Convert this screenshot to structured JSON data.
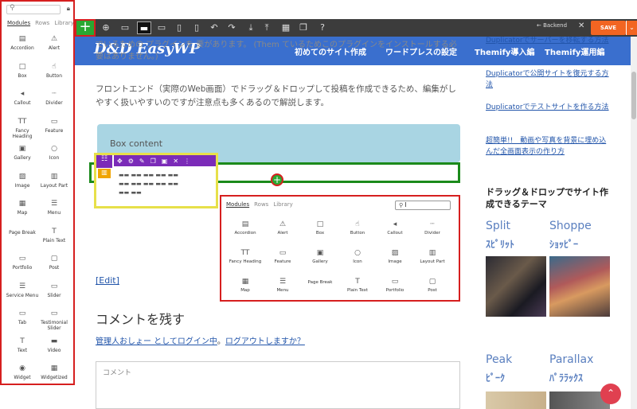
{
  "side_panel": {
    "tabs": [
      "Modules",
      "Rows",
      "Library"
    ],
    "modules": [
      {
        "label": "Accordion",
        "icon": "accordion-icon",
        "glyph": "▤"
      },
      {
        "label": "Alert",
        "icon": "alert-icon",
        "glyph": "⚠"
      },
      {
        "label": "Box",
        "icon": "box-icon",
        "glyph": "□"
      },
      {
        "label": "Button",
        "icon": "button-icon",
        "glyph": "☝"
      },
      {
        "label": "Callout",
        "icon": "callout-icon",
        "glyph": "◂"
      },
      {
        "label": "Divider",
        "icon": "divider-icon",
        "glyph": "┈"
      },
      {
        "label": "Fancy Heading",
        "icon": "fancy-heading-icon",
        "glyph": "TT"
      },
      {
        "label": "Feature",
        "icon": "feature-icon",
        "glyph": "▭"
      },
      {
        "label": "Gallery",
        "icon": "gallery-icon",
        "glyph": "▣"
      },
      {
        "label": "Icon",
        "icon": "icon-icon",
        "glyph": "○"
      },
      {
        "label": "Image",
        "icon": "image-icon",
        "glyph": "▨"
      },
      {
        "label": "Layout Part",
        "icon": "layout-part-icon",
        "glyph": "▥"
      },
      {
        "label": "Map",
        "icon": "map-icon",
        "glyph": "▦"
      },
      {
        "label": "Menu",
        "icon": "menu-icon",
        "glyph": "☰"
      },
      {
        "label": "Page Break",
        "icon": "page-break-icon",
        "glyph": ""
      },
      {
        "label": "Plain Text",
        "icon": "plain-text-icon",
        "glyph": "T"
      },
      {
        "label": "Portfolio",
        "icon": "portfolio-icon",
        "glyph": "▭"
      },
      {
        "label": "Post",
        "icon": "post-icon",
        "glyph": "▢"
      },
      {
        "label": "Service Menu",
        "icon": "service-menu-icon",
        "glyph": "☰"
      },
      {
        "label": "Slider",
        "icon": "slider-icon",
        "glyph": "▭"
      },
      {
        "label": "Tab",
        "icon": "tab-icon",
        "glyph": "▭"
      },
      {
        "label": "Testimonial Slider",
        "icon": "testimonial-slider-icon",
        "glyph": "▭"
      },
      {
        "label": "Text",
        "icon": "text-icon",
        "glyph": "T"
      },
      {
        "label": "Video",
        "icon": "video-icon",
        "glyph": "▬"
      },
      {
        "label": "Widget",
        "icon": "widget-icon",
        "glyph": "◉"
      },
      {
        "label": "Widgetized",
        "icon": "widgetized-icon",
        "glyph": "▦"
      }
    ]
  },
  "toolbar": {
    "add_label": "+",
    "backend_label": "← Backend",
    "close_label": "✕",
    "save_label": "SAVE",
    "save_arrow": "⌄"
  },
  "header": {
    "logo": "D&D EasyWP",
    "nav": [
      "初めてのサイト作成",
      "ワードプレスの設定",
      "Themify導入編",
      "Themify運用編"
    ],
    "behind_text": "Themifyのデータ すべてのThemifyのテーマやプラグインを使用する場合は、どのThemify Builder でいるための プラグインを 要があります。 (Them ているためこのプラグインをインストールする必要はありません。)"
  },
  "content": {
    "intro": "フロントエンド（実際のWeb画面）でドラッグ＆ドロップして投稿を作成できるため、編集がしやすく扱いやすいのですが注意点も多くあるので解説します。",
    "box_content": "Box content",
    "row_grid": [
      "▬▬ ▬▬ ▬▬ ▬▬ ▬▬",
      "▬▬ ▬▬ ▬▬ ▬▬ ▬▬",
      "▬▬ ▬▬"
    ],
    "edit_link": "[Edit]",
    "comment_title": "コメントを残す",
    "logged_prefix": "管理人おしょー としてログイン中",
    "logged_sep": "。",
    "logout_link": "ログアウトしますか？",
    "comment_placeholder": "コメント"
  },
  "popup": {
    "tabs": [
      "Modules",
      "Rows",
      "Library"
    ],
    "search_value": "I",
    "modules": [
      {
        "label": "Accordion",
        "glyph": "▤"
      },
      {
        "label": "Alert",
        "glyph": "⚠"
      },
      {
        "label": "Box",
        "glyph": "□"
      },
      {
        "label": "Button",
        "glyph": "☝"
      },
      {
        "label": "Callout",
        "glyph": "◂"
      },
      {
        "label": "Divider",
        "glyph": "┈"
      },
      {
        "label": "Fancy Heading",
        "glyph": "TT"
      },
      {
        "label": "Feature",
        "glyph": "▭"
      },
      {
        "label": "Gallery",
        "glyph": "▣"
      },
      {
        "label": "Icon",
        "glyph": "○"
      },
      {
        "label": "Image",
        "glyph": "▨"
      },
      {
        "label": "Layout Part",
        "glyph": "▥"
      },
      {
        "label": "Map",
        "glyph": "▦"
      },
      {
        "label": "Menu",
        "glyph": "☰"
      },
      {
        "label": "Page Break",
        "glyph": ""
      },
      {
        "label": "Plain Text",
        "glyph": "T"
      },
      {
        "label": "Portfolio",
        "glyph": "▭"
      },
      {
        "label": "Post",
        "glyph": "▢"
      }
    ]
  },
  "sidebar": {
    "links": [
      "Duplicatorでサーバーを移転する方法",
      "Duplicatorで公開サイトを復元する方法",
      "Duplicatorでテストサイトを作る方法",
      "超簡単!!　動画や写真を背景に埋め込んだ全画面表示の作り方"
    ],
    "section_title": "ドラッグ＆ドロップでサイト作成できるテーマ",
    "themes": [
      {
        "name": "Split",
        "jp": "ｽﾋﾟﾘｯﾄ"
      },
      {
        "name": "Shoppe",
        "jp": "ｼｮｯﾋﾟｰ"
      },
      {
        "name": "Peak",
        "jp": "ﾋﾟｰｸ"
      },
      {
        "name": "Parallax",
        "jp": "ﾊﾟﾗﾗｯｸｽ"
      }
    ]
  },
  "colors": {
    "accent_green": "#2aa832",
    "highlight_red": "#d61f1f",
    "toolbar_bg": "#3c3c3c",
    "header_blue": "#3a6fce",
    "save_orange": "#f26522",
    "builder_purple": "#7b2bb8"
  }
}
